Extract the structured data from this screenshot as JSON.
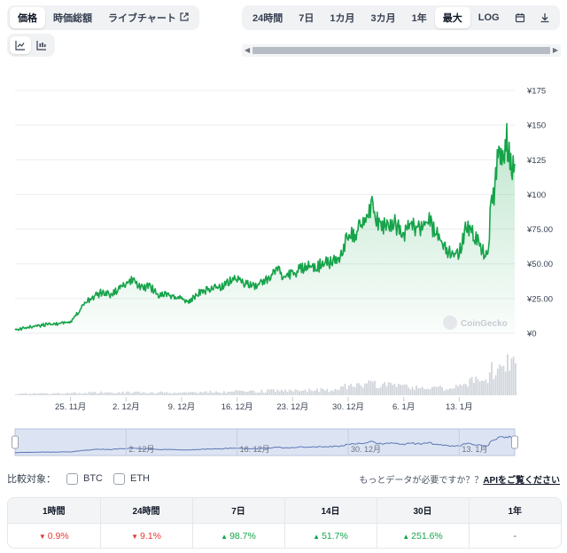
{
  "tabs": [
    {
      "label": "価格",
      "active": true
    },
    {
      "label": "時価総額",
      "active": false
    },
    {
      "label": "ライブチャート",
      "active": false,
      "external": true
    }
  ],
  "ranges": [
    {
      "label": "24時間",
      "active": false
    },
    {
      "label": "7日",
      "active": false
    },
    {
      "label": "1カ月",
      "active": false
    },
    {
      "label": "3カ月",
      "active": false
    },
    {
      "label": "1年",
      "active": false
    },
    {
      "label": "最大",
      "active": true
    },
    {
      "label": "LOG",
      "active": false
    }
  ],
  "toolbar_icons": [
    "calendar-icon",
    "download-icon"
  ],
  "chart_toggle": [
    {
      "icon": "line-chart-icon",
      "active": true
    },
    {
      "icon": "candlestick-chart-icon",
      "active": false
    }
  ],
  "watermark": "CoinGecko",
  "chart_data": {
    "type": "area",
    "y_ticks": [
      "¥175",
      "¥150",
      "¥125",
      "¥100",
      "¥75.00",
      "¥50.00",
      "¥25.00",
      "¥0"
    ],
    "ylim": [
      0,
      175
    ],
    "x_ticks": [
      "25. 11月",
      "2. 12月",
      "9. 12月",
      "16. 12月",
      "23. 12月",
      "30. 12月",
      "6. 1月",
      "13. 1月"
    ],
    "x_tick_days": [
      7,
      14,
      21,
      28,
      35,
      42,
      49,
      56
    ],
    "x_range_days": [
      0,
      63
    ],
    "line_color": "#16a34a",
    "series": [
      {
        "values": [
          [
            0,
            3
          ],
          [
            1,
            4
          ],
          [
            2,
            5
          ],
          [
            3,
            6
          ],
          [
            4,
            7
          ],
          [
            5,
            7
          ],
          [
            6,
            8
          ],
          [
            7,
            9
          ],
          [
            8,
            16
          ],
          [
            9,
            24
          ],
          [
            10,
            28
          ],
          [
            11,
            31
          ],
          [
            12,
            29
          ],
          [
            13,
            33
          ],
          [
            14,
            38
          ],
          [
            15,
            40
          ],
          [
            16,
            34
          ],
          [
            17,
            36
          ],
          [
            18,
            28
          ],
          [
            19,
            30
          ],
          [
            20,
            27
          ],
          [
            21,
            26
          ],
          [
            22,
            24
          ],
          [
            23,
            30
          ],
          [
            24,
            32
          ],
          [
            25,
            35
          ],
          [
            26,
            34
          ],
          [
            27,
            40
          ],
          [
            28,
            42
          ],
          [
            29,
            38
          ],
          [
            30,
            35
          ],
          [
            31,
            38
          ],
          [
            32,
            42
          ],
          [
            33,
            48
          ],
          [
            34,
            42
          ],
          [
            35,
            45
          ],
          [
            36,
            48
          ],
          [
            37,
            50
          ],
          [
            38,
            50
          ],
          [
            39,
            53
          ],
          [
            40,
            53
          ],
          [
            41,
            58
          ],
          [
            42,
            74
          ],
          [
            43,
            76
          ],
          [
            44,
            84
          ],
          [
            45,
            96
          ],
          [
            46,
            82
          ],
          [
            47,
            80
          ],
          [
            48,
            82
          ],
          [
            49,
            75
          ],
          [
            50,
            82
          ],
          [
            51,
            79
          ],
          [
            52,
            85
          ],
          [
            53,
            78
          ],
          [
            54,
            67
          ],
          [
            55,
            59
          ],
          [
            56,
            61
          ],
          [
            57,
            82
          ],
          [
            58,
            72
          ],
          [
            58.8,
            65
          ],
          [
            59.2,
            58
          ],
          [
            59.6,
            57
          ],
          [
            60,
            98
          ],
          [
            60.5,
            108
          ],
          [
            61,
            140
          ],
          [
            61.5,
            135
          ],
          [
            62,
            147
          ],
          [
            62.5,
            128
          ],
          [
            63,
            122
          ]
        ]
      }
    ],
    "volume": {
      "values": [
        [
          0,
          1
        ],
        [
          10,
          2
        ],
        [
          20,
          2
        ],
        [
          30,
          3
        ],
        [
          40,
          4
        ],
        [
          42,
          7
        ],
        [
          45,
          8
        ],
        [
          50,
          6
        ],
        [
          55,
          5
        ],
        [
          57,
          10
        ],
        [
          58,
          12
        ],
        [
          59,
          9
        ],
        [
          60,
          18
        ],
        [
          61,
          24
        ],
        [
          62,
          28
        ],
        [
          63,
          22
        ]
      ],
      "max": 30
    },
    "navigator": {
      "x_ticks": [
        "2. 12月",
        "16. 12月",
        "30. 12月",
        "13. 1月"
      ],
      "x_tick_days": [
        14,
        28,
        42,
        56
      ]
    }
  },
  "compare": {
    "label": "比較対象：",
    "options": [
      "BTC",
      "ETH"
    ]
  },
  "more_data": {
    "text": "もっとデータが必要ですか？？",
    "link": "APIをご覧ください"
  },
  "perf_table": {
    "headers": [
      "1時間",
      "24時間",
      "7日",
      "14日",
      "30日",
      "1年"
    ],
    "values": [
      {
        "text": "0.9%",
        "dir": "down"
      },
      {
        "text": "9.1%",
        "dir": "down"
      },
      {
        "text": "98.7%",
        "dir": "up"
      },
      {
        "text": "51.7%",
        "dir": "up"
      },
      {
        "text": "251.6%",
        "dir": "up"
      },
      {
        "text": "-",
        "dir": "none"
      }
    ],
    "colors": {
      "down": "#e53935",
      "up": "#16a34a"
    }
  }
}
